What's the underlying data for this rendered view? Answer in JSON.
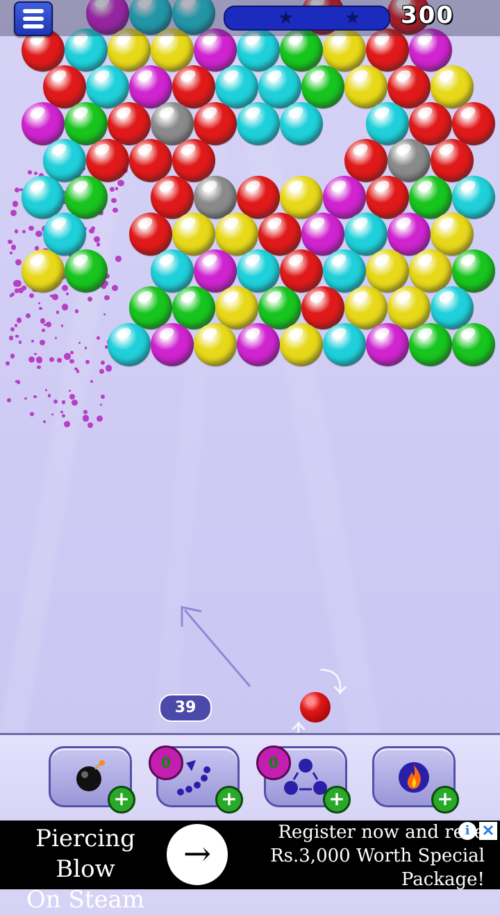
{
  "hud": {
    "score": "300",
    "menu_icon": "hamburger-menu-icon",
    "progress_stars": 2
  },
  "shooter": {
    "shots_left": "39",
    "current_bubble": "red",
    "swap_icon": "swap-arrows-icon"
  },
  "colors": {
    "R": "#e01a1a",
    "C": "#1fd0da",
    "Y": "#e7d81a",
    "G": "#18c41e",
    "M": "#cf24cf",
    "S": "#8a8a8a",
    "accent": "#1a2bbd"
  },
  "board": {
    "rows": [
      "..MCC..R.R.Y",
      "RCYYMCGYRM",
      ".RCMRCCGYRY",
      "MGRSRCC.CRR",
      ".CRRR...RSR",
      "CG.RSRYMRGC",
      ".C.RYYRMCMYY",
      "YG.CMCRCYYG",
      "...GGYGRYYCY",
      "..CMYMYCMGG"
    ]
  },
  "powerups": [
    {
      "name": "bomb",
      "icon": "bomb-icon",
      "count": null
    },
    {
      "name": "aim-guide",
      "icon": "aim-guide-icon",
      "count": "0"
    },
    {
      "name": "color-swap",
      "icon": "color-change-icon",
      "count": "0"
    },
    {
      "name": "fireball",
      "icon": "fire-icon",
      "count": null
    }
  ],
  "ad": {
    "left_line1": "Piercing Blow",
    "left_line2": "On Steam",
    "right_line1": "Register now and rece",
    "right_line2": "Rs.3,000 Worth Special",
    "right_line3": "Package!",
    "info_glyph": "i",
    "close_glyph": "✕",
    "arrow_glyph": "→"
  }
}
